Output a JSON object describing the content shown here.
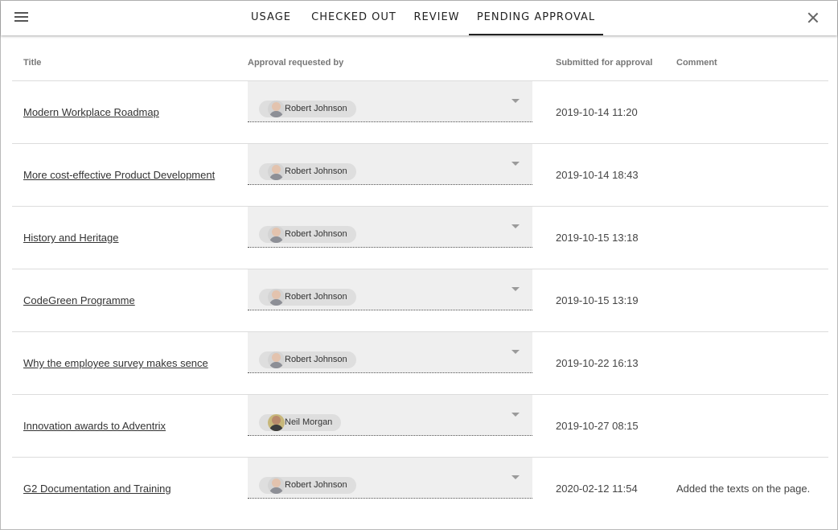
{
  "tabs": [
    {
      "label": "USAGE"
    },
    {
      "label": "CHECKED OUT"
    },
    {
      "label": "REVIEW"
    },
    {
      "label": "PENDING APPROVAL",
      "active": true
    }
  ],
  "icons": {
    "menu": "hamburger-menu-icon",
    "close": "close-icon",
    "caret": "chevron-down-icon"
  },
  "columns": {
    "title": "Title",
    "requested_by": "Approval requested by",
    "submitted": "Submitted for approval",
    "comment": "Comment"
  },
  "rows": [
    {
      "title": "Modern Workplace Roadmap",
      "requested_by": "Robert Johnson",
      "submitted": "2019-10-14 11:20",
      "comment": ""
    },
    {
      "title": "More cost-effective Product Development",
      "requested_by": "Robert Johnson",
      "submitted": "2019-10-14 18:43",
      "comment": ""
    },
    {
      "title": "History and Heritage",
      "requested_by": "Robert Johnson",
      "submitted": "2019-10-15 13:18",
      "comment": ""
    },
    {
      "title": "CodeGreen Programme",
      "requested_by": "Robert Johnson",
      "submitted": "2019-10-15 13:19",
      "comment": ""
    },
    {
      "title": "Why the employee survey makes sence",
      "requested_by": "Robert Johnson",
      "submitted": "2019-10-22 16:13",
      "comment": ""
    },
    {
      "title": "Innovation awards to Adventrix",
      "requested_by": "Neil Morgan",
      "submitted": "2019-10-27 08:15",
      "comment": ""
    },
    {
      "title": "G2 Documentation and Training",
      "requested_by": "Robert Johnson",
      "submitted": "2020-02-12 11:54",
      "comment": "Added the texts on the page."
    }
  ]
}
